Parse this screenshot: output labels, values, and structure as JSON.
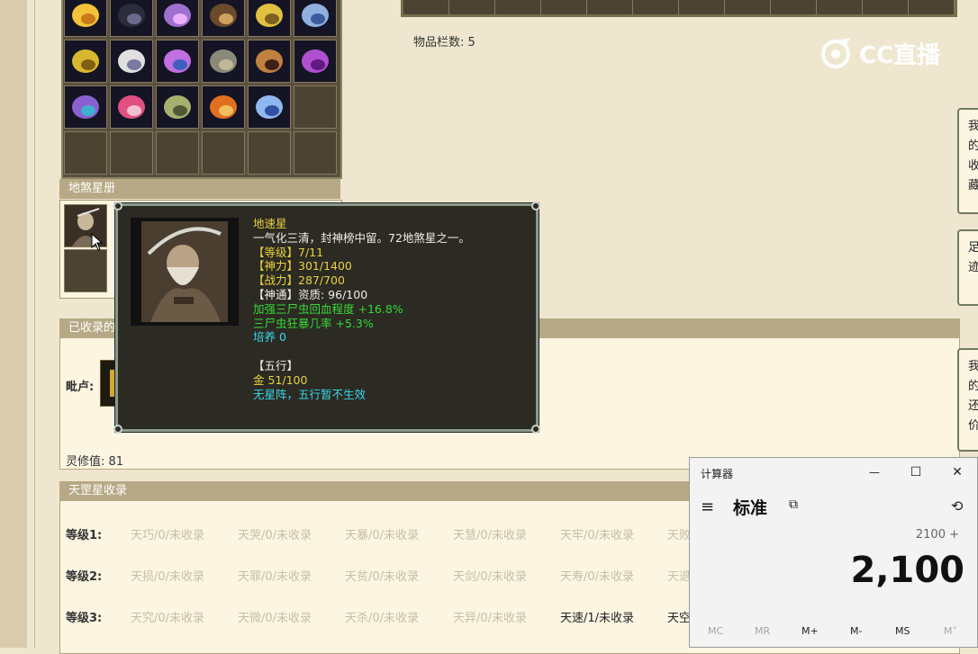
{
  "inventory": {
    "slot_count_label": "物品栏数: 5"
  },
  "dishaxing": {
    "header": "地煞星册"
  },
  "collected": {
    "header": "已收录的",
    "row_label": "毗卢:",
    "spirit_value": "灵修值: 81"
  },
  "tooltip": {
    "name": "地速星",
    "description": "一气化三清，封神榜中留。72地煞星之一。",
    "level": "【等级】7/11",
    "power": "【神力】301/1400",
    "combat": "【战力】287/700",
    "divine": "【神通】资质: 96/100",
    "bonus1": "加强三尸虫回血程度 +16.8%",
    "bonus2": "三尸虫狂暴几率 +5.3%",
    "cultivate": "培养 0",
    "wuxing_header": "【五行】",
    "gold": "金 51/100",
    "formation": "无星阵，五行暂不生效"
  },
  "tiangang": {
    "header": "天罡星收录",
    "levels": [
      {
        "label": "等级1:",
        "cells": [
          "天巧/0/未收录",
          "天哭/0/未收录",
          "天暴/0/未收录",
          "天慧/0/未收录",
          "天牢/0/未收录",
          "天败"
        ]
      },
      {
        "label": "等级2:",
        "cells": [
          "天损/0/未收录",
          "天罪/0/未收录",
          "天贫/0/未收录",
          "天剑/0/未收录",
          "天寿/0/未收录",
          "天退"
        ]
      },
      {
        "label": "等级3:",
        "cells": [
          "天究/0/未收录",
          "天微/0/未收录",
          "天杀/0/未收录",
          "天异/0/未收录",
          "天速/1/未收录",
          "天空"
        ]
      }
    ]
  },
  "right_notes": [
    {
      "text": "我\n的\n收\n藏"
    },
    {
      "text": "足\n迹"
    },
    {
      "text": "我\n的\n还\n价"
    }
  ],
  "watermark": {
    "text": "CC直播"
  },
  "calculator": {
    "title": "计算器",
    "minimize": "—",
    "maximize": "☐",
    "close": "✕",
    "menu": "≡",
    "mode": "标准",
    "keep_on_top": "⧉",
    "history": "⟲",
    "expression": "2100 +",
    "display": "2,100",
    "memory": [
      "MC",
      "MR",
      "M+",
      "M-",
      "MS",
      "M˅"
    ]
  }
}
